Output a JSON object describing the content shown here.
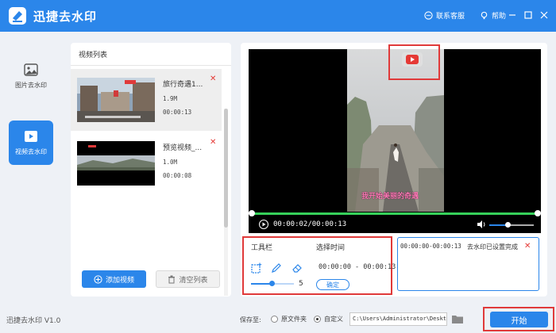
{
  "app": {
    "title": "迅捷去水印",
    "version": "迅捷去水印 V1.0"
  },
  "titlebar": {
    "service_label": "联系客服",
    "help_label": "帮助"
  },
  "nav": [
    {
      "label": "图片去水印",
      "icon": "image-icon",
      "active": false
    },
    {
      "label": "视频去水印",
      "icon": "video-icon",
      "active": true
    }
  ],
  "video_list": {
    "header": "视频列表",
    "items": [
      {
        "name": "旅行奇遇1...",
        "size": "1.9M",
        "duration": "00:00:13",
        "selected": true
      },
      {
        "name": "预览视频_...",
        "size": "1.0M",
        "duration": "00:00:08",
        "selected": false
      }
    ],
    "add_label": "添加视频",
    "clear_label": "清空列表"
  },
  "player": {
    "time": "00:00:02/00:00:13",
    "subtitle": "我开始美丽的奇遇",
    "progress_fraction": 1.0,
    "volume_fraction": 0.4
  },
  "toolbar": {
    "title": "工具栏",
    "tools": [
      "rect-select-icon",
      "pen-icon",
      "eraser-icon"
    ],
    "brush_size": "5",
    "brush_fraction": 0.5
  },
  "time_select": {
    "title": "选择时间",
    "range": "00:00:00 - 00:00:13",
    "confirm_label": "确定"
  },
  "watermark_list": [
    {
      "time": "00:00:00-00:00:13",
      "status": "去水印已设置完成"
    }
  ],
  "bottom": {
    "save_to": "保存至:",
    "option_original": "原文件夹",
    "option_custom": "自定义",
    "path": "C:\\Users\\Administrator\\Desktop",
    "start_label": "开始"
  },
  "colors": {
    "accent": "#2b86ea",
    "highlight": "#e03a3a",
    "progress": "#36d15a"
  }
}
